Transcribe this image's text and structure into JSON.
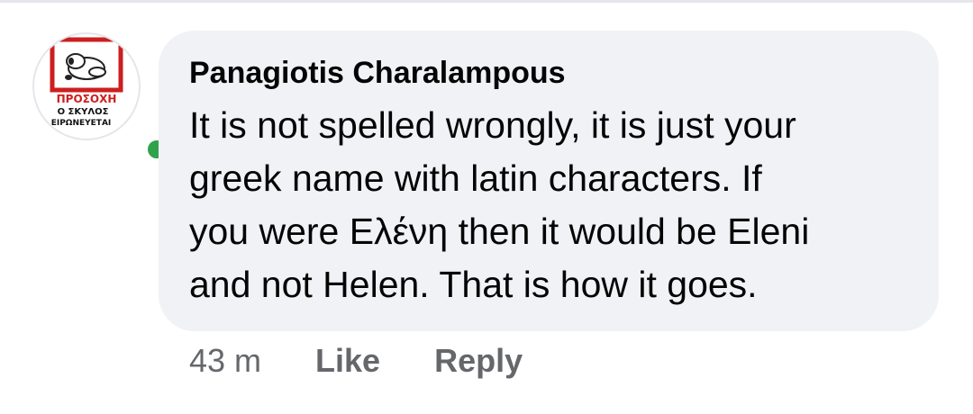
{
  "comment": {
    "author": "Panagiotis Charalampous",
    "text_lines": [
      "It is not spelled wrongly, it is just your",
      "greek name with latin characters. If",
      "you were Ελένη then it would be Eleni",
      "and not Helen. That is how it goes."
    ],
    "timestamp": "43 m",
    "actions": {
      "like_label": "Like",
      "reply_label": "Reply"
    }
  },
  "avatar": {
    "sign_text_lines": [
      "ΠΡΟΣΟΧΗ",
      "Ο ΣΚΥΛΟΣ",
      "ΕΙΡΩΝΕΥΕΤΑΙ"
    ],
    "online": true
  },
  "colors": {
    "bubble_bg": "#f0f2f5",
    "text": "#050505",
    "secondary_text": "#65676b",
    "presence": "#31a24c",
    "sign_red": "#cc1f1f"
  },
  "icons": {
    "avatar_image": "warning-dog-sign",
    "presence_indicator": "online-dot"
  }
}
